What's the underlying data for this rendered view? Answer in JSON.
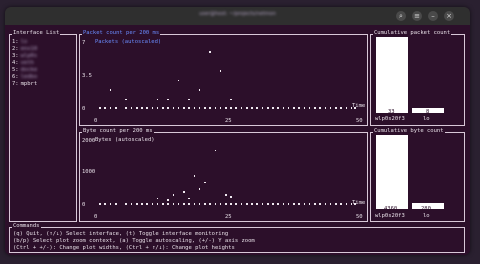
{
  "window": {
    "title": "user@host: ~/projects/netmon",
    "buttons": [
      "search",
      "menu",
      "minimize",
      "close"
    ]
  },
  "interface_list": {
    "title": "Interface List",
    "items": [
      {
        "index": "1:",
        "name": "lo"
      },
      {
        "index": "2:",
        "name": "enx10"
      },
      {
        "index": "3:",
        "name": "wlp0s"
      },
      {
        "index": "4:",
        "name": "veth"
      },
      {
        "index": "5:",
        "name": "docke"
      },
      {
        "index": "6:",
        "name": "ledbo"
      },
      {
        "index": "7:",
        "name": "mpbrt"
      }
    ]
  },
  "packet_chart": {
    "title": "Packet count per 200 ms",
    "legend": "Packets (autoscaled)",
    "legend_color": "#6a8cff",
    "y_ticks": [
      "7",
      "3.5",
      "0"
    ],
    "x_ticks": [
      "0",
      "25",
      "50"
    ],
    "x_label": "Time"
  },
  "byte_chart": {
    "title": "Byte count per 200 ms",
    "legend": "Bytes (autoscaled)",
    "y_ticks": [
      "2000",
      "1000",
      "0"
    ],
    "x_ticks": [
      "0",
      "25",
      "50"
    ],
    "x_label": "Time"
  },
  "cumulative_packets": {
    "title": "Cumulative packet count",
    "bars": [
      {
        "value": "33",
        "label": "wlp0s20f3",
        "fraction": 1.0
      },
      {
        "value": "8",
        "label": "lo",
        "fraction": 0.05
      }
    ]
  },
  "cumulative_bytes": {
    "title": "Cumulative byte count",
    "bars": [
      {
        "value": "4360",
        "label": "wlp0s20f3",
        "fraction": 1.0
      },
      {
        "value": "280",
        "label": "lo",
        "fraction": 0.08
      }
    ]
  },
  "commands": {
    "title": "Commands",
    "lines": [
      "(q) Quit, (↑/↓) Select interface, (t) Toggle interface monitoring",
      "(b/p) Select plot zoom context, (a) Toggle autoscaling, (+/-) Y axis zoom",
      "(Ctrl + +/-): Change plot widths, (Ctrl + ↑/↓): Change plot heights"
    ]
  },
  "chart_data": [
    {
      "type": "scatter",
      "title": "Packet count per 200 ms",
      "series": [
        {
          "name": "Packets (autoscaled)",
          "x": [
            1,
            2,
            3,
            4,
            6,
            7,
            8,
            9,
            10,
            11,
            12,
            13,
            14,
            15,
            16,
            17,
            18,
            19,
            20,
            21,
            22,
            23,
            24,
            25,
            26,
            27,
            28,
            29,
            30,
            31,
            32,
            33,
            34,
            35,
            36,
            37,
            38,
            39,
            40,
            41,
            42,
            43,
            44,
            45,
            46,
            47,
            48,
            49,
            50,
            52,
            3,
            16,
            18,
            22,
            24,
            12,
            6,
            20,
            26,
            14
          ],
          "y": [
            0,
            0,
            0,
            0,
            0,
            0,
            0,
            0,
            0,
            0,
            0,
            0,
            0,
            0,
            0,
            0,
            0,
            0,
            0,
            0,
            0,
            0,
            0,
            0,
            0,
            0,
            0,
            0,
            0,
            0,
            0,
            0,
            0,
            0,
            0,
            0,
            0,
            0,
            0,
            0,
            0,
            0,
            0,
            0,
            0,
            0,
            0,
            0,
            0,
            0,
            2,
            3,
            1,
            6,
            4,
            1,
            1,
            2,
            1,
            1
          ]
        }
      ],
      "xlim": [
        0,
        50
      ],
      "ylim": [
        0,
        7
      ],
      "xlabel": "Time"
    },
    {
      "type": "scatter",
      "title": "Byte count per 200 ms",
      "series": [
        {
          "name": "Bytes (autoscaled)",
          "x": [
            1,
            2,
            3,
            4,
            6,
            7,
            8,
            9,
            10,
            11,
            12,
            13,
            14,
            15,
            16,
            17,
            18,
            19,
            20,
            21,
            22,
            23,
            24,
            25,
            26,
            27,
            28,
            29,
            30,
            31,
            32,
            33,
            34,
            35,
            36,
            37,
            38,
            39,
            40,
            41,
            42,
            43,
            44,
            45,
            46,
            47,
            48,
            49,
            50,
            17,
            19,
            21,
            23,
            15,
            25,
            12,
            20,
            14,
            26,
            18
          ],
          "y": [
            0,
            0,
            0,
            0,
            0,
            0,
            0,
            0,
            0,
            0,
            0,
            0,
            0,
            0,
            0,
            0,
            0,
            0,
            0,
            0,
            0,
            0,
            0,
            0,
            0,
            0,
            0,
            0,
            0,
            0,
            0,
            0,
            0,
            0,
            0,
            0,
            0,
            0,
            0,
            0,
            0,
            0,
            0,
            0,
            0,
            0,
            0,
            0,
            0,
            400,
            900,
            700,
            1700,
            300,
            300,
            200,
            500,
            150,
            250,
            200
          ]
        }
      ],
      "xlim": [
        0,
        50
      ],
      "ylim": [
        0,
        2000
      ],
      "xlabel": "Time"
    }
  ]
}
